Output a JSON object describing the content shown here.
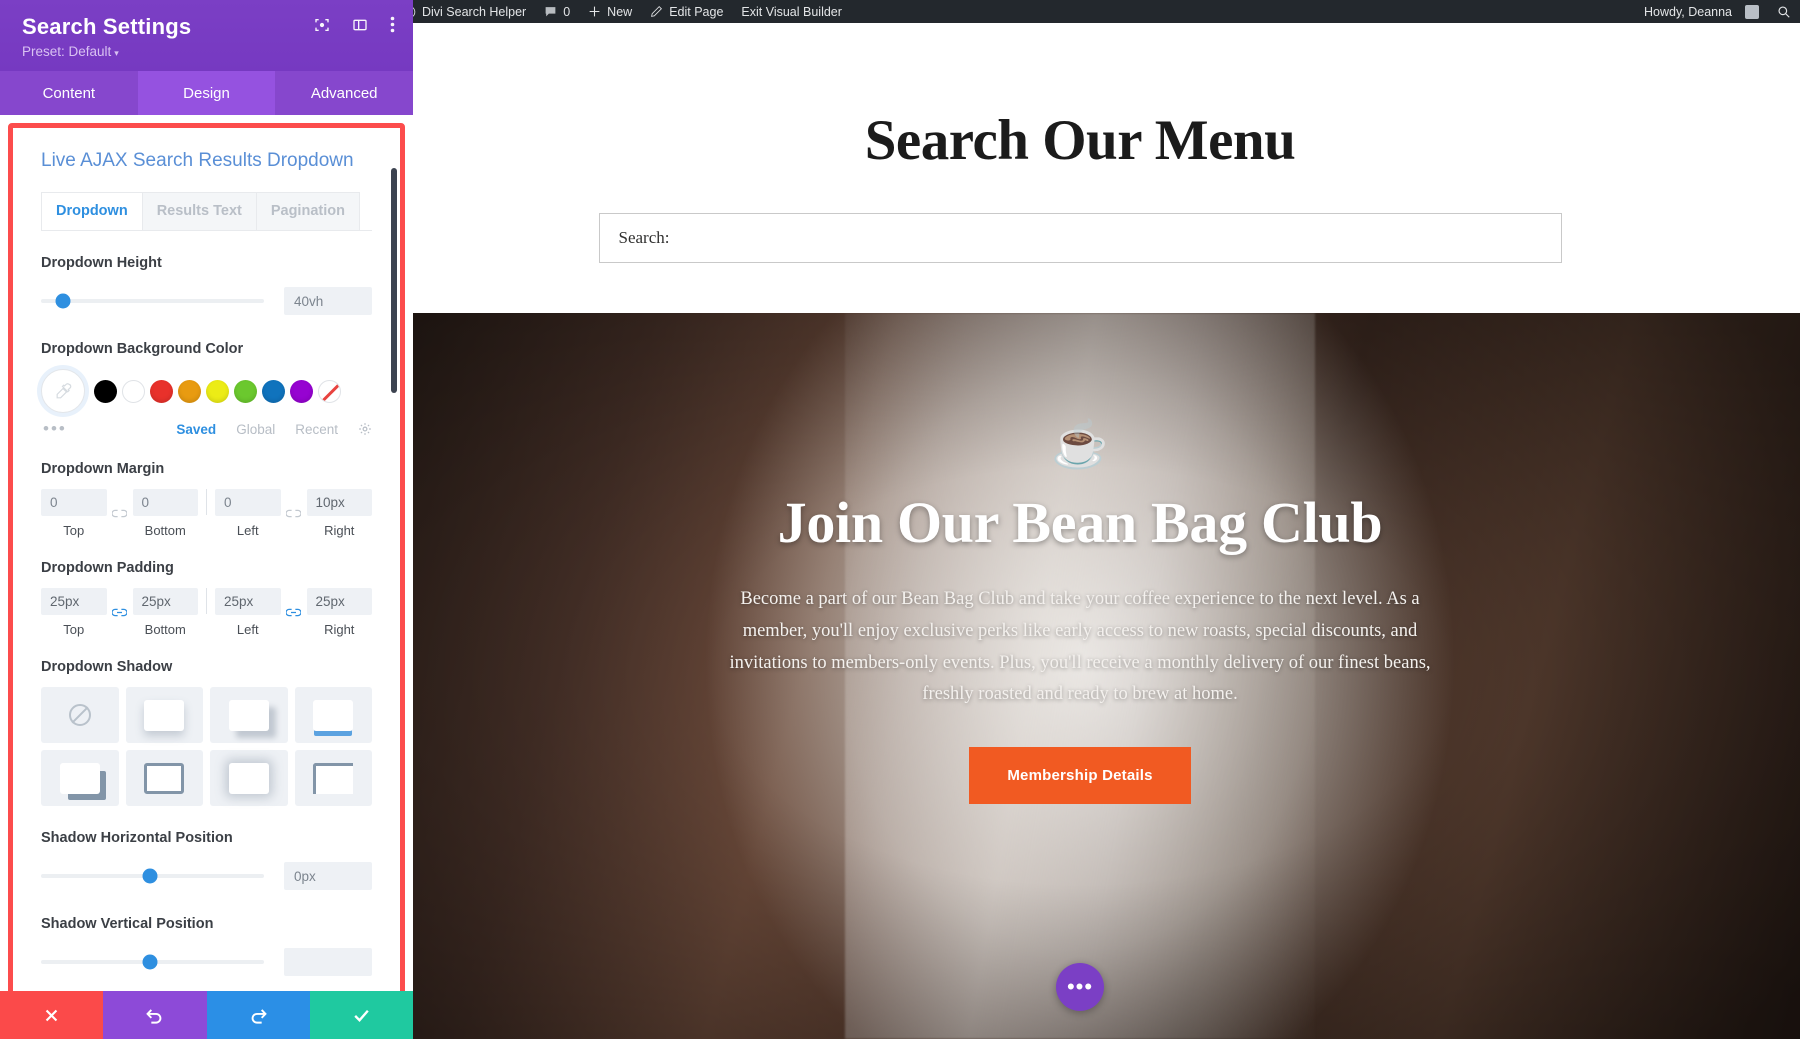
{
  "panel": {
    "title": "Search Settings",
    "preset": "Preset: Default",
    "preset_caret": "▾",
    "header_icons": [
      "focus-icon",
      "layout-icon",
      "more-vertical-icon"
    ],
    "tabs": [
      {
        "label": "Content",
        "active": false
      },
      {
        "label": "Design",
        "active": true
      },
      {
        "label": "Advanced",
        "active": false
      }
    ],
    "module_title": "Live AJAX Search Results Dropdown",
    "subtabs": [
      {
        "label": "Dropdown",
        "active": true
      },
      {
        "label": "Results Text",
        "active": false
      },
      {
        "label": "Pagination",
        "active": false
      }
    ],
    "fields": {
      "dropdown_height": {
        "label": "Dropdown Height",
        "value": "40vh",
        "knob_percent": 10
      },
      "background_color": {
        "label": "Dropdown Background Color",
        "swatches": [
          {
            "name": "black",
            "hex": "#000000"
          },
          {
            "name": "white",
            "hex": "#ffffff"
          },
          {
            "name": "red",
            "hex": "#e8312b"
          },
          {
            "name": "orange",
            "hex": "#e89b11"
          },
          {
            "name": "yellow",
            "hex": "#ecec16"
          },
          {
            "name": "green",
            "hex": "#6bc82e"
          },
          {
            "name": "blue",
            "hex": "#1073bd"
          },
          {
            "name": "purple",
            "hex": "#9603d1"
          },
          {
            "name": "none",
            "hex": "transparent"
          }
        ],
        "dots": "•••",
        "links": [
          {
            "label": "Saved",
            "active": true
          },
          {
            "label": "Global",
            "active": false
          },
          {
            "label": "Recent",
            "active": false
          }
        ]
      },
      "margin": {
        "label": "Dropdown Margin",
        "linked": false,
        "values": [
          {
            "caption": "Top",
            "value": "0"
          },
          {
            "caption": "Bottom",
            "value": "0"
          },
          {
            "caption": "Left",
            "value": "0"
          },
          {
            "caption": "Right",
            "value": "10px"
          }
        ]
      },
      "padding": {
        "label": "Dropdown Padding",
        "linked": true,
        "values": [
          {
            "caption": "Top",
            "value": "25px"
          },
          {
            "caption": "Bottom",
            "value": "25px"
          },
          {
            "caption": "Left",
            "value": "25px"
          },
          {
            "caption": "Right",
            "value": "25px"
          }
        ]
      },
      "shadow": {
        "label": "Dropdown Shadow",
        "presets": [
          "none",
          "soft-bottom",
          "offset-down-right",
          "underline-blue",
          "hard-offset",
          "outline",
          "blurred-glow",
          "corner-bracket"
        ]
      },
      "shadow_horizontal": {
        "label": "Shadow Horizontal Position",
        "value": "0px",
        "knob_percent": 49
      },
      "shadow_vertical": {
        "label": "Shadow Vertical Position",
        "value": "",
        "knob_percent": 49
      }
    },
    "actions": [
      {
        "name": "cancel-button",
        "glyph": "✕",
        "color": "#fb4a4a"
      },
      {
        "name": "undo-button",
        "glyph": "↺",
        "color": "#8d4ad8"
      },
      {
        "name": "redo-button",
        "glyph": "↻",
        "color": "#2b8fe6"
      },
      {
        "name": "save-button",
        "glyph": "✔",
        "color": "#1fc9a0"
      }
    ]
  },
  "adminbar": {
    "items": [
      {
        "name": "wordpress-logo-icon",
        "label": ""
      },
      {
        "name": "site-name",
        "label": "Divi Search Helper"
      },
      {
        "name": "comments",
        "label": "0"
      },
      {
        "name": "new-content",
        "label": "New"
      },
      {
        "name": "edit-page",
        "label": "Edit Page"
      },
      {
        "name": "exit-visual-builder",
        "label": "Exit Visual Builder"
      }
    ],
    "howdy": "Howdy, Deanna",
    "search_icon": "search-icon"
  },
  "page": {
    "search_title": "Search Our Menu",
    "search_placeholder": "Search:",
    "search_value": "Search:",
    "hero": {
      "icon": "coffee-cup-icon",
      "title": "Join Our Bean Bag Club",
      "body": "Become a part of our Bean Bag Club and take your coffee experience to the next level. As a member, you'll enjoy exclusive perks like early access to new roasts, special discounts, and invitations to members-only events. Plus, you'll receive a monthly delivery of our finest beans, freshly roasted and ready to brew at home.",
      "button": "Membership Details",
      "fab": "•••"
    }
  }
}
